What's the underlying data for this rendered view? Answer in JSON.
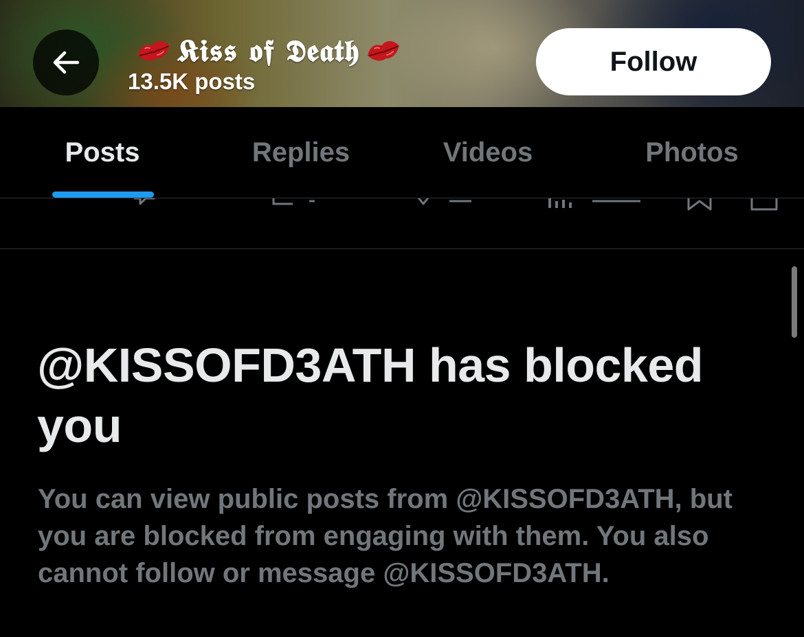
{
  "header": {
    "back_icon": "arrow-left-icon",
    "profile_name": "𝕶𝖎𝖘𝖘 𝖔𝖋 𝕯𝖊𝖆𝖙𝖍",
    "name_decoration_icon": "kiss-lips-icon",
    "post_count": "13.5K posts",
    "follow_label": "Follow"
  },
  "tabs": [
    {
      "label": "Posts",
      "active": true
    },
    {
      "label": "Replies",
      "active": false
    },
    {
      "label": "Videos",
      "active": false
    },
    {
      "label": "Photos",
      "active": false
    }
  ],
  "action_row": {
    "icons": [
      "reply-icon",
      "repost-icon",
      "like-icon",
      "views-icon",
      "bookmark-icon",
      "share-icon"
    ]
  },
  "blocked": {
    "title": "@KISSOFD3ATH has blocked you",
    "description": "You can view public posts from @KISSOFD3ATH, but you are blocked from engaging with them. You also cannot follow or message @KISSOFD3ATH."
  },
  "colors": {
    "background": "#000000",
    "accent": "#1d9bf0",
    "primary_text": "#e7e9ea",
    "secondary_text": "#71767b",
    "divider": "#2f3336",
    "follow_button_bg": "#ffffff"
  }
}
